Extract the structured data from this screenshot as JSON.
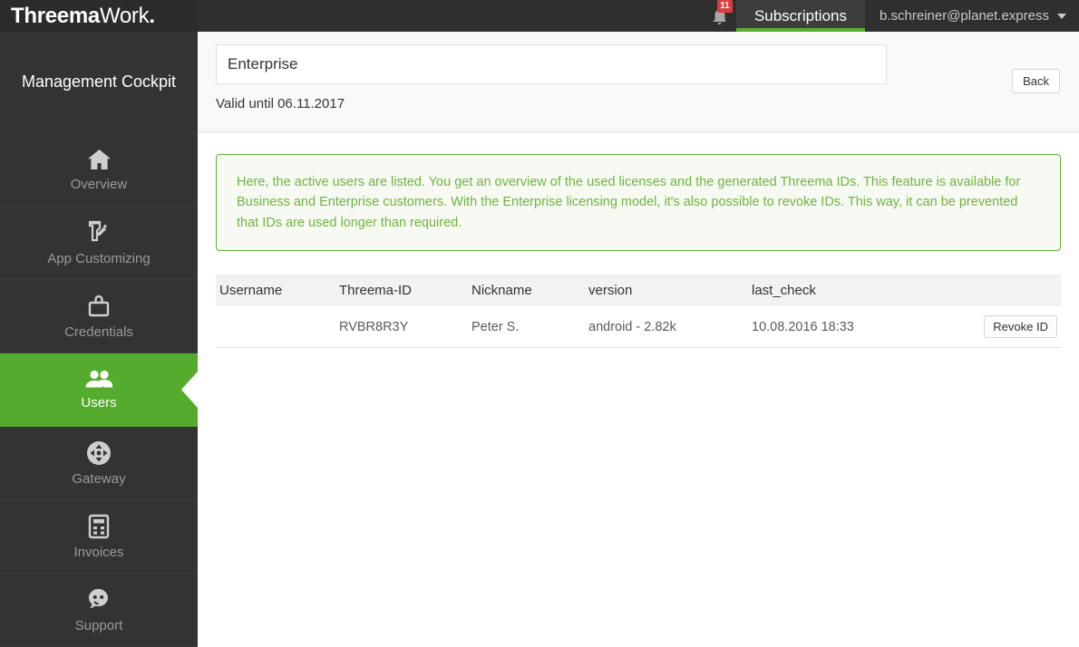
{
  "topbar": {
    "logo_primary": "Threema",
    "logo_secondary": "Work",
    "logo_dot": ".",
    "notification_count": "11",
    "notification_icon": "bell-icon",
    "tab_label": "Subscriptions",
    "user_email": "b.schreiner@planet.express",
    "accent_color": "#5aad2f",
    "badge_color": "#e03d3d"
  },
  "sidebar": {
    "title": "Management Cockpit",
    "items": [
      {
        "label": "Overview",
        "icon": "home-icon",
        "active": false
      },
      {
        "label": "App Customizing",
        "icon": "phone-pencil-icon",
        "active": false
      },
      {
        "label": "Credentials",
        "icon": "briefcase-lock-icon",
        "active": false
      },
      {
        "label": "Users",
        "icon": "users-icon",
        "active": true
      },
      {
        "label": "Gateway",
        "icon": "gateway-arrows-icon",
        "active": false
      },
      {
        "label": "Invoices",
        "icon": "calculator-icon",
        "active": false
      },
      {
        "label": "Support",
        "icon": "support-face-icon",
        "active": false
      }
    ],
    "active_color": "#55ab2e"
  },
  "main": {
    "plan_name": "Enterprise",
    "valid_until": "Valid until 06.11.2017",
    "back_label": "Back",
    "info_text": "Here, the active users are listed. You get an overview of the used licenses and the generated Threema IDs. This feature is available for Business and Enterprise customers. With the Enterprise licensing model, it's also possible to revoke IDs. This way, it can be prevented that IDs are used longer than required.",
    "info_color": "#6eb43e",
    "table": {
      "columns": [
        "Username",
        "Threema-ID",
        "Nickname",
        "version",
        "last_check",
        ""
      ],
      "rows": [
        {
          "username": "",
          "threema_id": "RVBR8R3Y",
          "nickname": "Peter S.",
          "version": "android - 2.82k",
          "last_check": "10.08.2016 18:33",
          "action_label": "Revoke ID"
        }
      ]
    }
  }
}
